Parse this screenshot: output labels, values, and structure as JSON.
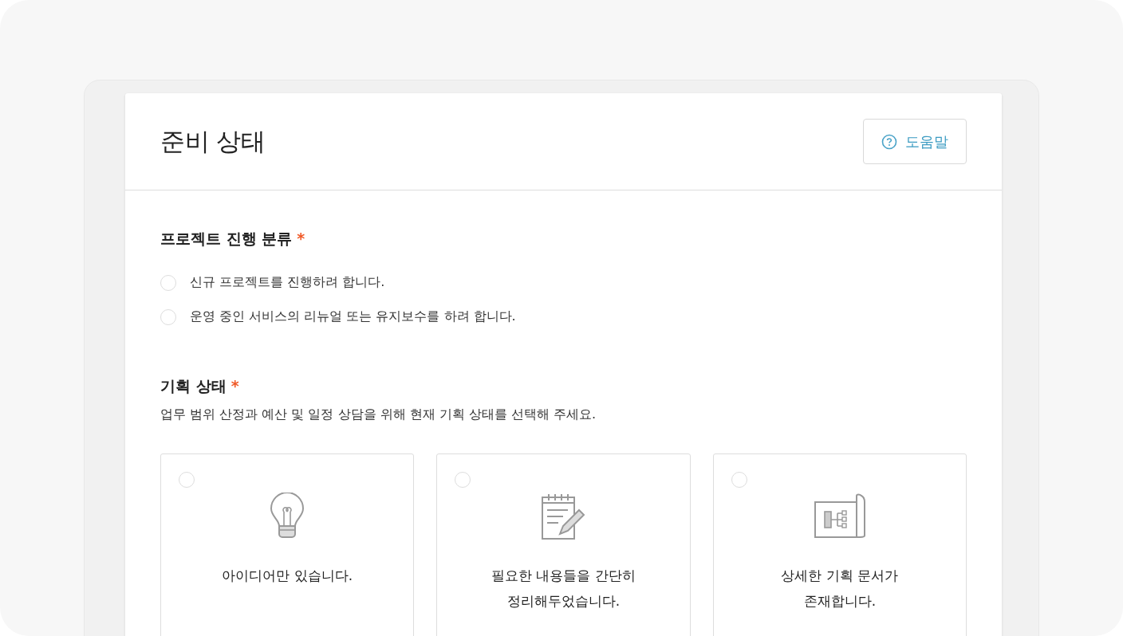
{
  "header": {
    "title": "준비 상태",
    "help_button": "도움말"
  },
  "sections": [
    {
      "title": "프로젝트 진행 분류",
      "required_mark": "*",
      "kind": "radio_list",
      "options": [
        {
          "label": "신규 프로젝트를 진행하려 합니다.",
          "selected": false
        },
        {
          "label": "운영 중인 서비스의 리뉴얼 또는 유지보수를 하려 합니다.",
          "selected": false
        }
      ]
    },
    {
      "title": "기획 상태",
      "required_mark": "*",
      "description": "업무 범위 산정과 예산 및 일정 상담을 위해 현재 기획 상태를 선택해 주세요.",
      "kind": "card_grid",
      "options": [
        {
          "kind": "idea",
          "label": "아이디어만 있습니다.",
          "selected": false
        },
        {
          "kind": "notes",
          "label": "필요한 내용들을 간단히\n정리해두었습니다.",
          "selected": false
        },
        {
          "kind": "document",
          "label": "상세한 기획 문서가\n존재합니다.",
          "selected": false
        }
      ]
    }
  ]
}
